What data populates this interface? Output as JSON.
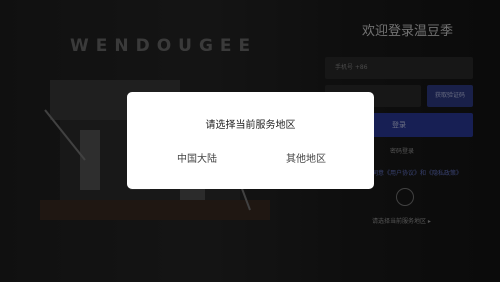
{
  "background": {
    "brand_logo": "WENDOUGEE",
    "login": {
      "title": "欢迎登录温豆季",
      "phone_placeholder": "手机号 +86",
      "code_button": "获取验证码",
      "login_button": "登录",
      "password_link": "密码登录",
      "agreement": "同意《用户协议》和《隐私政策》",
      "region_link": "请选择当前服务地区 ▸"
    }
  },
  "dialog": {
    "title": "请选择当前服务地区",
    "options": [
      "中国大陆",
      "其他地区"
    ]
  }
}
